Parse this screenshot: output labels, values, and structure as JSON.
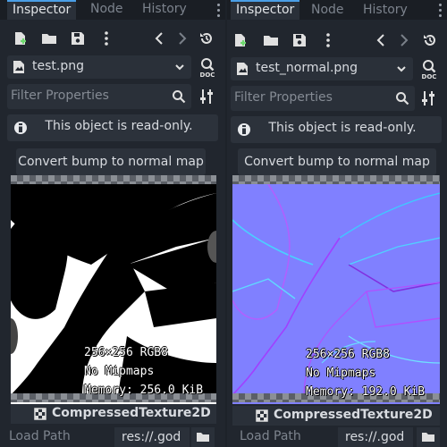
{
  "dock_left": {
    "tabs": [
      {
        "label": "Inspector",
        "active": true
      },
      {
        "label": "Node"
      },
      {
        "label": "History"
      }
    ],
    "resource": {
      "name": "test.png"
    },
    "filter": {
      "placeholder": "Filter Properties"
    },
    "readonly_message": "This object is read-only.",
    "convert_button": "Convert bump to normal map",
    "preview": {
      "size_format": "256×256 RGB8",
      "mipmaps": "No Mipmaps",
      "memory": "Memory: 256.0 KiB"
    },
    "class_name": "CompressedTexture2D",
    "property": {
      "name": "Load Path",
      "value": "res://.god"
    }
  },
  "dock_right": {
    "tabs": [
      {
        "label": "Inspector",
        "active": true
      },
      {
        "label": "Node"
      },
      {
        "label": "History"
      }
    ],
    "resource": {
      "name": "test_normal.png"
    },
    "filter": {
      "placeholder": "Filter Properties"
    },
    "readonly_message": "This object is read-only.",
    "convert_button": "Convert bump to normal map",
    "preview": {
      "size_format": "256×256 RGB8",
      "mipmaps": "No Mipmaps",
      "memory": "Memory: 192.0 KiB"
    },
    "class_name": "CompressedTexture2D",
    "property": {
      "name": "Load Path",
      "value": "res://.god"
    }
  },
  "colors": {
    "background": "#21262e",
    "field": "#2a3039",
    "accent": "#4a9ee6",
    "normal_map": "#8080ff"
  },
  "icons": [
    "new-resource-icon",
    "open-folder-icon",
    "save-icon",
    "kebab-menu-icon",
    "back-arrow-icon",
    "forward-arrow-icon",
    "history-icon",
    "texture-file-icon",
    "chevron-down-icon",
    "doc-icon",
    "search-icon",
    "tools-icon",
    "info-icon",
    "class-icon",
    "folder-icon"
  ]
}
